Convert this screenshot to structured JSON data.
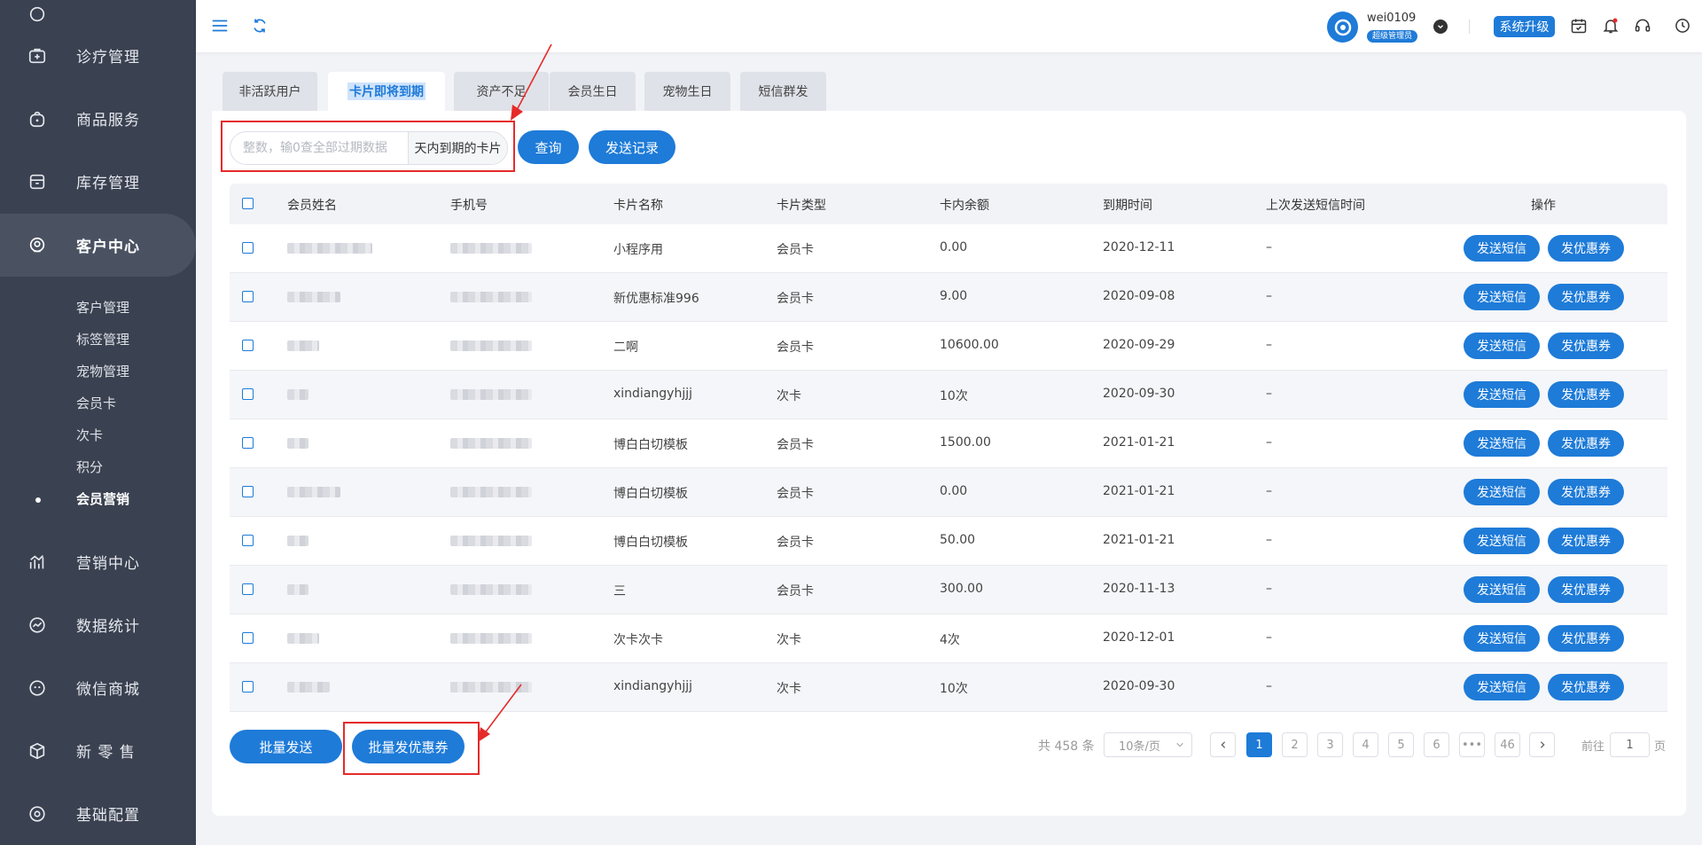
{
  "sidebar": {
    "items": [
      {
        "label": "诊疗管理",
        "icon": "medical-kit-icon"
      },
      {
        "label": "商品服务",
        "icon": "shopping-bag-icon"
      },
      {
        "label": "库存管理",
        "icon": "inventory-box-icon"
      },
      {
        "label": "客户中心",
        "icon": "customer-icon"
      },
      {
        "label": "营销中心",
        "icon": "marketing-chart-icon"
      },
      {
        "label": "数据统计",
        "icon": "statistics-icon"
      },
      {
        "label": "微信商城",
        "icon": "wechat-icon"
      },
      {
        "label": "新 零 售",
        "icon": "retail-cube-icon"
      },
      {
        "label": "基础配置",
        "icon": "settings-icon"
      }
    ],
    "subitems": [
      "客户管理",
      "标签管理",
      "宠物管理",
      "会员卡",
      "次卡",
      "积分",
      "会员营销"
    ]
  },
  "header": {
    "username": "wei0109",
    "role": "超级管理员",
    "upgrade_label": "系统升级"
  },
  "tabs": [
    "非活跃用户",
    "卡片即将到期",
    "资产不足",
    "会员生日",
    "宠物生日",
    "短信群发"
  ],
  "search": {
    "placeholder": "整数，输0查全部过期数据",
    "suffix": "天内到期的卡片",
    "query_label": "查询",
    "records_label": "发送记录"
  },
  "table": {
    "headers": [
      "会员姓名",
      "手机号",
      "卡片名称",
      "卡片类型",
      "卡内余额",
      "到期时间",
      "上次发送短信时间",
      "操作"
    ],
    "rows": [
      {
        "card": "小程序用",
        "type": "会员卡",
        "balance": "0.00",
        "expire": "2020-12-11",
        "last": "–"
      },
      {
        "card": "新优惠标准996",
        "type": "会员卡",
        "balance": "9.00",
        "expire": "2020-09-08",
        "last": "–"
      },
      {
        "card": "二啊",
        "type": "会员卡",
        "balance": "10600.00",
        "expire": "2020-09-29",
        "last": "–"
      },
      {
        "card": "xindiangyhjjj",
        "type": "次卡",
        "balance": "10次",
        "expire": "2020-09-30",
        "last": "–"
      },
      {
        "card": "博白白切模板",
        "type": "会员卡",
        "balance": "1500.00",
        "expire": "2021-01-21",
        "last": "–"
      },
      {
        "card": "博白白切模板",
        "type": "会员卡",
        "balance": "0.00",
        "expire": "2021-01-21",
        "last": "–"
      },
      {
        "card": "博白白切模板",
        "type": "会员卡",
        "balance": "50.00",
        "expire": "2021-01-21",
        "last": "–"
      },
      {
        "card": "三",
        "type": "会员卡",
        "balance": "300.00",
        "expire": "2020-11-13",
        "last": "–"
      },
      {
        "card": "次卡次卡",
        "type": "次卡",
        "balance": "4次",
        "expire": "2020-12-01",
        "last": "–"
      },
      {
        "card": "xindiangyhjjj",
        "type": "次卡",
        "balance": "10次",
        "expire": "2020-09-30",
        "last": "–"
      }
    ],
    "op_sms": "发送短信",
    "op_coupon": "发优惠券"
  },
  "footer": {
    "batch_send": "批量发送",
    "batch_coupon": "批量发优惠券",
    "total": "共 458 条",
    "page_size": "10条/页",
    "pages": [
      "1",
      "2",
      "3",
      "4",
      "5",
      "6",
      "•••",
      "46"
    ],
    "goto_prefix": "前往",
    "goto_value": "1",
    "goto_suffix": "页"
  },
  "colors": {
    "primary": "#1e7bd8",
    "sidebar": "#3a4150",
    "annotation": "#e52a2a"
  }
}
